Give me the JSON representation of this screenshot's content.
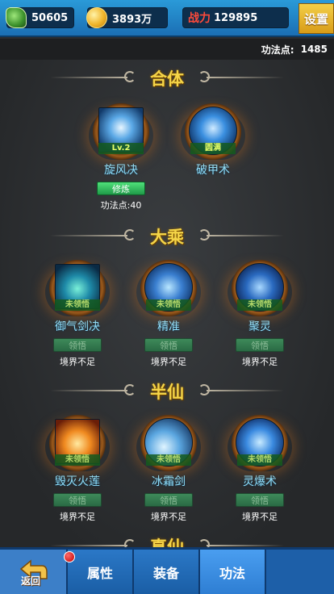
{
  "topbar": {
    "jade": "50605",
    "gold": "3893万",
    "power_label": "战力",
    "power_value": "129895",
    "settings_label": "设置"
  },
  "points": {
    "label": "功法点:",
    "value": "1485"
  },
  "sections": [
    {
      "title": "合体",
      "skills": [
        {
          "name": "旋风决",
          "tag": "Lv.2",
          "button": "修炼",
          "note": "功法点:40"
        },
        {
          "name": "破甲术",
          "tag": "圆满"
        }
      ]
    },
    {
      "title": "大乘",
      "skills": [
        {
          "name": "御气剑决",
          "tag": "未领悟",
          "button": "领悟",
          "note": "境界不足"
        },
        {
          "name": "精准",
          "tag": "未领悟",
          "button": "领悟",
          "note": "境界不足"
        },
        {
          "name": "聚灵",
          "tag": "未领悟",
          "button": "领悟",
          "note": "境界不足"
        }
      ]
    },
    {
      "title": "半仙",
      "skills": [
        {
          "name": "毁灭火莲",
          "tag": "未领悟",
          "button": "领悟",
          "note": "境界不足"
        },
        {
          "name": "冰霜剑",
          "tag": "未领悟",
          "button": "领悟",
          "note": "境界不足"
        },
        {
          "name": "灵爆术",
          "tag": "未领悟",
          "button": "领悟",
          "note": "境界不足"
        }
      ]
    },
    {
      "title": "真仙"
    }
  ],
  "nav": {
    "back_label": "返回",
    "tabs": [
      "属性",
      "装备",
      "功法"
    ],
    "active_tab": "功法"
  },
  "colors": {
    "topbar": "#1b6fb4",
    "section_title": "#f5d548",
    "skill_name": "#8fe1ff",
    "power_label": "#ff4a3a",
    "active_button": "#2fb85a"
  },
  "icons": {
    "jade": "jade-currency-icon",
    "gold": "gold-coin-icon",
    "back": "back-arrow-icon",
    "notification": "red-dot-icon"
  }
}
